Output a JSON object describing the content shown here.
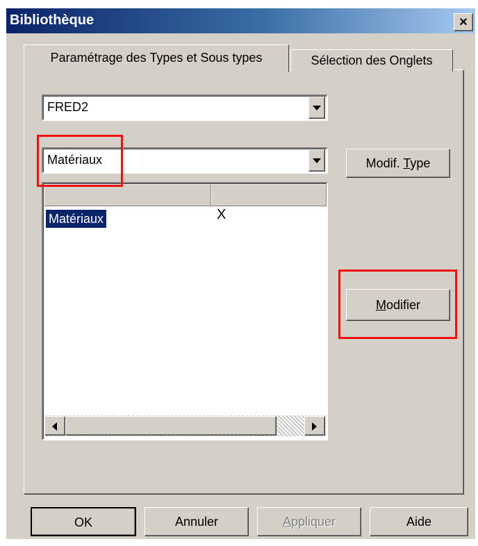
{
  "window": {
    "title": "Bibliothèque",
    "close_symbol": "×"
  },
  "tabs": [
    {
      "label": "Paramétrage des Types et Sous types",
      "active": true
    },
    {
      "label": "Sélection des Onglets",
      "active": false
    }
  ],
  "combo_library": {
    "value": "FRED2"
  },
  "combo_type": {
    "value": "Matériaux"
  },
  "buttons": {
    "modif_type_prefix": "Modif. ",
    "modif_type_mnemonic": "T",
    "modif_type_suffix": "ype",
    "modifier_mnemonic": "M",
    "modifier_suffix": "odifier",
    "ok": "OK",
    "annuler": "Annuler",
    "appliquer_mnemonic": "A",
    "appliquer_suffix": "ppliquer",
    "aide": "Aide"
  },
  "list": {
    "columns": [
      "",
      ""
    ],
    "rows": [
      {
        "name": "Matériaux",
        "mark": "X",
        "selected": true
      }
    ]
  },
  "icons": {
    "dropdown": "down-arrow",
    "scroll_left": "left-arrow",
    "scroll_right": "right-arrow",
    "close": "close-x"
  },
  "colors": {
    "highlight": "#ee1111",
    "titlebar_start": "#0a246a",
    "titlebar_end": "#a6caf0",
    "selection": "#0a246a",
    "face": "#d4d0c8"
  }
}
